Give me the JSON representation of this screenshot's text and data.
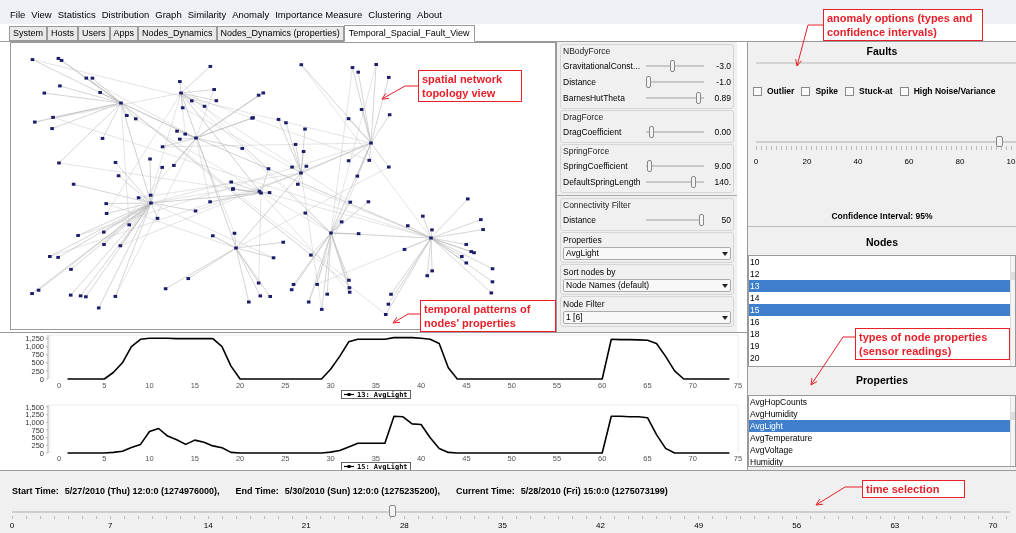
{
  "menu": [
    "File",
    "View",
    "Statistics",
    "Distribution",
    "Graph",
    "Similarity",
    "Anomaly",
    "Importance Measure",
    "Clustering",
    "About"
  ],
  "tabs": [
    {
      "label": "System",
      "selected": false
    },
    {
      "label": "Hosts",
      "selected": false
    },
    {
      "label": "Users",
      "selected": false
    },
    {
      "label": "Apps",
      "selected": false
    },
    {
      "label": "Nodes_Dynamics",
      "selected": false
    },
    {
      "label": "Nodes_Dynamics (properties)",
      "selected": false
    },
    {
      "label": "Temporal_Spacial_Fault_View",
      "selected": true
    }
  ],
  "force_groups": [
    {
      "title": "NBodyForce",
      "sliders": [
        {
          "label": "GravitationalConst...",
          "level": 0.45,
          "reading": "-3.0"
        },
        {
          "label": "Distance",
          "level": 0.0,
          "reading": "-1.0"
        },
        {
          "label": "BarnesHutTheta",
          "level": 0.95,
          "reading": "0.89"
        }
      ]
    },
    {
      "title": "DragForce",
      "sliders": [
        {
          "label": "DragCoefficient",
          "level": 0.05,
          "reading": "0.00"
        }
      ]
    },
    {
      "title": "SpringForce",
      "sliders": [
        {
          "label": "SpringCoefficient",
          "level": 0.02,
          "reading": "9.00"
        },
        {
          "label": "DefaultSpringLength",
          "level": 0.85,
          "reading": "140."
        }
      ]
    },
    {
      "title": "Connectivity Filter",
      "sliders": [
        {
          "label": "Distance",
          "level": 1.0,
          "reading": "50"
        }
      ]
    }
  ],
  "dropdowns": [
    {
      "title": "Properties",
      "value": "AvgLight"
    },
    {
      "title": "Sort nodes by",
      "value": "Node Names (default)"
    },
    {
      "title": "Node Filter",
      "value": "1 [6]"
    }
  ],
  "faults": {
    "title": "Faults",
    "options": [
      {
        "label": "Outlier",
        "checked": false
      },
      {
        "label": "Spike",
        "checked": false
      },
      {
        "label": "Stuck-at",
        "checked": false
      },
      {
        "label": "High Noise/Variance",
        "checked": false
      }
    ],
    "slider": {
      "level": 0.95,
      "ticks": [
        "0",
        "20",
        "40",
        "60",
        "80",
        "10"
      ]
    },
    "caption": "Confidence Interval: 95%"
  },
  "nodes": {
    "title": "Nodes",
    "items": [
      {
        "label": "10",
        "selected": false
      },
      {
        "label": "12",
        "selected": false
      },
      {
        "label": "13",
        "selected": true
      },
      {
        "label": "14",
        "selected": false
      },
      {
        "label": "15",
        "selected": true
      },
      {
        "label": "16",
        "selected": false
      },
      {
        "label": "18",
        "selected": false
      },
      {
        "label": "19",
        "selected": false
      },
      {
        "label": "20",
        "selected": false
      }
    ]
  },
  "properties": {
    "title": "Properties",
    "items": [
      {
        "label": "AvgHopCounts",
        "selected": false
      },
      {
        "label": "AvgHumidity",
        "selected": false
      },
      {
        "label": "AvgLight",
        "selected": true
      },
      {
        "label": "AvgTemperature",
        "selected": false
      },
      {
        "label": "AvgVoltage",
        "selected": false
      },
      {
        "label": "Humidity",
        "selected": false
      }
    ]
  },
  "charts": [
    {
      "chart_data": {
        "type": "line",
        "x": [
          1,
          2,
          3,
          4,
          5,
          6,
          7,
          8,
          9,
          10,
          11,
          12,
          13,
          14,
          15,
          16,
          17,
          18,
          19,
          20,
          21,
          22,
          23,
          24,
          25,
          26,
          27,
          28,
          29,
          30,
          31,
          32,
          33,
          34,
          35,
          36,
          37,
          38,
          39,
          40,
          41,
          42,
          43,
          44,
          45,
          46,
          47,
          48,
          49,
          50,
          51,
          52,
          53,
          54,
          55,
          56,
          57,
          58,
          59,
          60,
          61,
          62,
          63,
          64,
          65,
          66,
          67,
          68,
          69,
          70,
          71,
          72,
          73,
          74
        ],
        "series": [
          {
            "name": "13: AvgLight",
            "color": "#000000",
            "values": [
              0,
              0,
              0,
              0,
              0,
              200,
              500,
              1000,
              1230,
              1260,
              1260,
              1260,
              1250,
              1250,
              1250,
              1250,
              1250,
              1000,
              400,
              0,
              0,
              0,
              0,
              0,
              0,
              0,
              0,
              0,
              0,
              300,
              700,
              1150,
              1230,
              1230,
              1230,
              1230,
              1280,
              1280,
              1280,
              1260,
              1230,
              1100,
              350,
              0,
              0,
              0,
              0,
              0,
              0,
              0,
              0,
              0,
              0,
              0,
              0,
              0,
              0,
              0,
              0,
              0,
              1230,
              1220,
              1220,
              1210,
              1200,
              1100,
              700,
              250,
              0,
              0,
              0,
              0,
              0,
              0
            ]
          }
        ],
        "xlim": [
          0,
          75
        ],
        "ylim": [
          0,
          1300
        ],
        "xticks": [
          0,
          5,
          10,
          15,
          20,
          25,
          30,
          35,
          40,
          45,
          50,
          55,
          60,
          65,
          70,
          75
        ],
        "yticks": [
          0,
          250,
          500,
          750,
          {
            "value": 1000,
            "label": "1,000"
          },
          {
            "value": 1250,
            "label": "1,250"
          }
        ]
      }
    },
    {
      "chart_data": {
        "type": "line",
        "x": [
          1,
          2,
          3,
          4,
          5,
          6,
          7,
          8,
          9,
          10,
          11,
          12,
          13,
          14,
          15,
          16,
          17,
          18,
          19,
          20,
          21,
          22,
          23,
          24,
          25,
          26,
          27,
          28,
          29,
          30,
          31,
          32,
          33,
          34,
          35,
          36,
          37,
          38,
          39,
          40,
          41,
          42,
          43,
          44,
          45,
          46,
          47,
          48,
          49,
          50,
          51,
          52,
          53,
          54,
          55,
          56,
          57,
          58,
          59,
          60,
          61,
          62,
          63,
          64,
          65,
          66,
          67,
          68,
          69,
          70,
          71,
          72,
          73,
          74
        ],
        "series": [
          {
            "name": "15: AvgLight",
            "color": "#000000",
            "values": [
              0,
              0,
              0,
              0,
              0,
              20,
              60,
              180,
              280,
              700,
              800,
              550,
              430,
              280,
              420,
              350,
              230,
              170,
              20,
              0,
              0,
              0,
              0,
              0,
              0,
              0,
              0,
              0,
              0,
              30,
              80,
              200,
              320,
              320,
              320,
              320,
              1200,
              1180,
              950,
              930,
              500,
              150,
              20,
              0,
              0,
              0,
              0,
              0,
              0,
              0,
              0,
              0,
              0,
              0,
              0,
              0,
              0,
              0,
              0,
              0,
              1200,
              1200,
              1180,
              1180,
              1150,
              600,
              150,
              0,
              0,
              0,
              0,
              0,
              0,
              0
            ]
          }
        ],
        "xlim": [
          0,
          75
        ],
        "ylim": [
          0,
          1500
        ],
        "xticks": [
          0,
          5,
          10,
          15,
          20,
          25,
          30,
          35,
          40,
          45,
          50,
          55,
          60,
          65,
          70,
          75
        ],
        "yticks": [
          0,
          250,
          500,
          750,
          {
            "value": 1000,
            "label": "1,000"
          },
          {
            "value": 1250,
            "label": "1,250"
          },
          {
            "value": 1500,
            "label": "1,500"
          }
        ]
      }
    }
  ],
  "time": {
    "fields": [
      {
        "label": "Start Time:",
        "value": "5/27/2010 (Thu) 12:0:0 (1274976000),"
      },
      {
        "label": "End Time:",
        "value": "5/30/2010 (Sun) 12:0:0 (1275235200),"
      },
      {
        "label": "Current Time:",
        "value": "5/28/2010 (Fri) 15:0:0 (1275073199)"
      }
    ],
    "slider": {
      "level": 0.38,
      "ticks": [
        "0",
        "7",
        "14",
        "21",
        "28",
        "35",
        "42",
        "49",
        "56",
        "63",
        "70"
      ]
    }
  },
  "annotations": [
    {
      "text": "anomaly options (types and confidence intervals)"
    },
    {
      "text": "spatial network topology view"
    },
    {
      "text": "temporal patterns of nodes' properties"
    },
    {
      "text": "types of node properties (sensor readings)"
    },
    {
      "text": "time selection"
    }
  ]
}
